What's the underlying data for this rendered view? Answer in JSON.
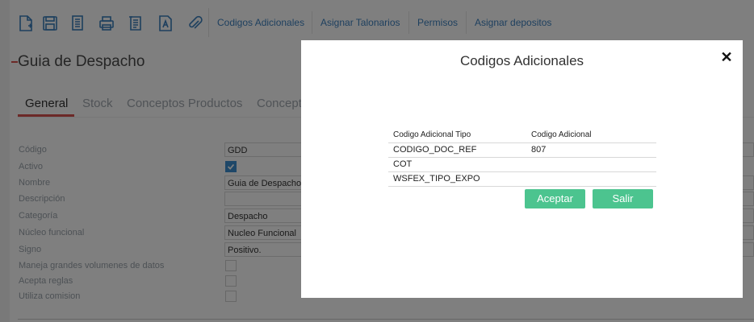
{
  "toolbar": {
    "icons": [
      "new-document-icon",
      "save-icon",
      "document-list-icon",
      "print-icon",
      "report-icon",
      "template-icon",
      "attachment-icon"
    ],
    "links": [
      "Codigos Adicionales",
      "Asignar Talonarios",
      "Permisos",
      "Asignar depositos"
    ]
  },
  "page": {
    "title": "Guia de Despacho",
    "tabs": [
      "General",
      "Stock",
      "Conceptos Productos",
      "Concept"
    ]
  },
  "form": {
    "labels": [
      "Código",
      "Activo",
      "Nombre",
      "Descripción",
      "Categoría",
      "Núcleo funcional",
      "Signo",
      "Maneja grandes volumenes de datos",
      "Acepta reglas",
      "Utiliza comision"
    ],
    "values": {
      "codigo": "GDD",
      "activo": true,
      "nombre": "Guia de Despacho",
      "descripcion": "",
      "categoria": "Despacho",
      "nucleo": "Nucleo Funcional",
      "signo": "Positivo.",
      "maneja": false,
      "acepta": false,
      "utiliza": false
    }
  },
  "modal": {
    "title": "Codigos Adicionales",
    "close_symbol": "✕",
    "columns": [
      "Codigo Adicional Tipo",
      "Codigo Adicional"
    ],
    "rows": [
      [
        "CODIGO_DOC_REF",
        "807"
      ],
      [
        "COT",
        ""
      ],
      [
        "WSFEX_TIPO_EXPO",
        ""
      ]
    ],
    "accept_label": "Aceptar",
    "exit_label": "Salir"
  },
  "colors": {
    "accent_blue": "#3d80bf",
    "accent_red": "#d9534f",
    "button_green": "#4cc48f"
  }
}
